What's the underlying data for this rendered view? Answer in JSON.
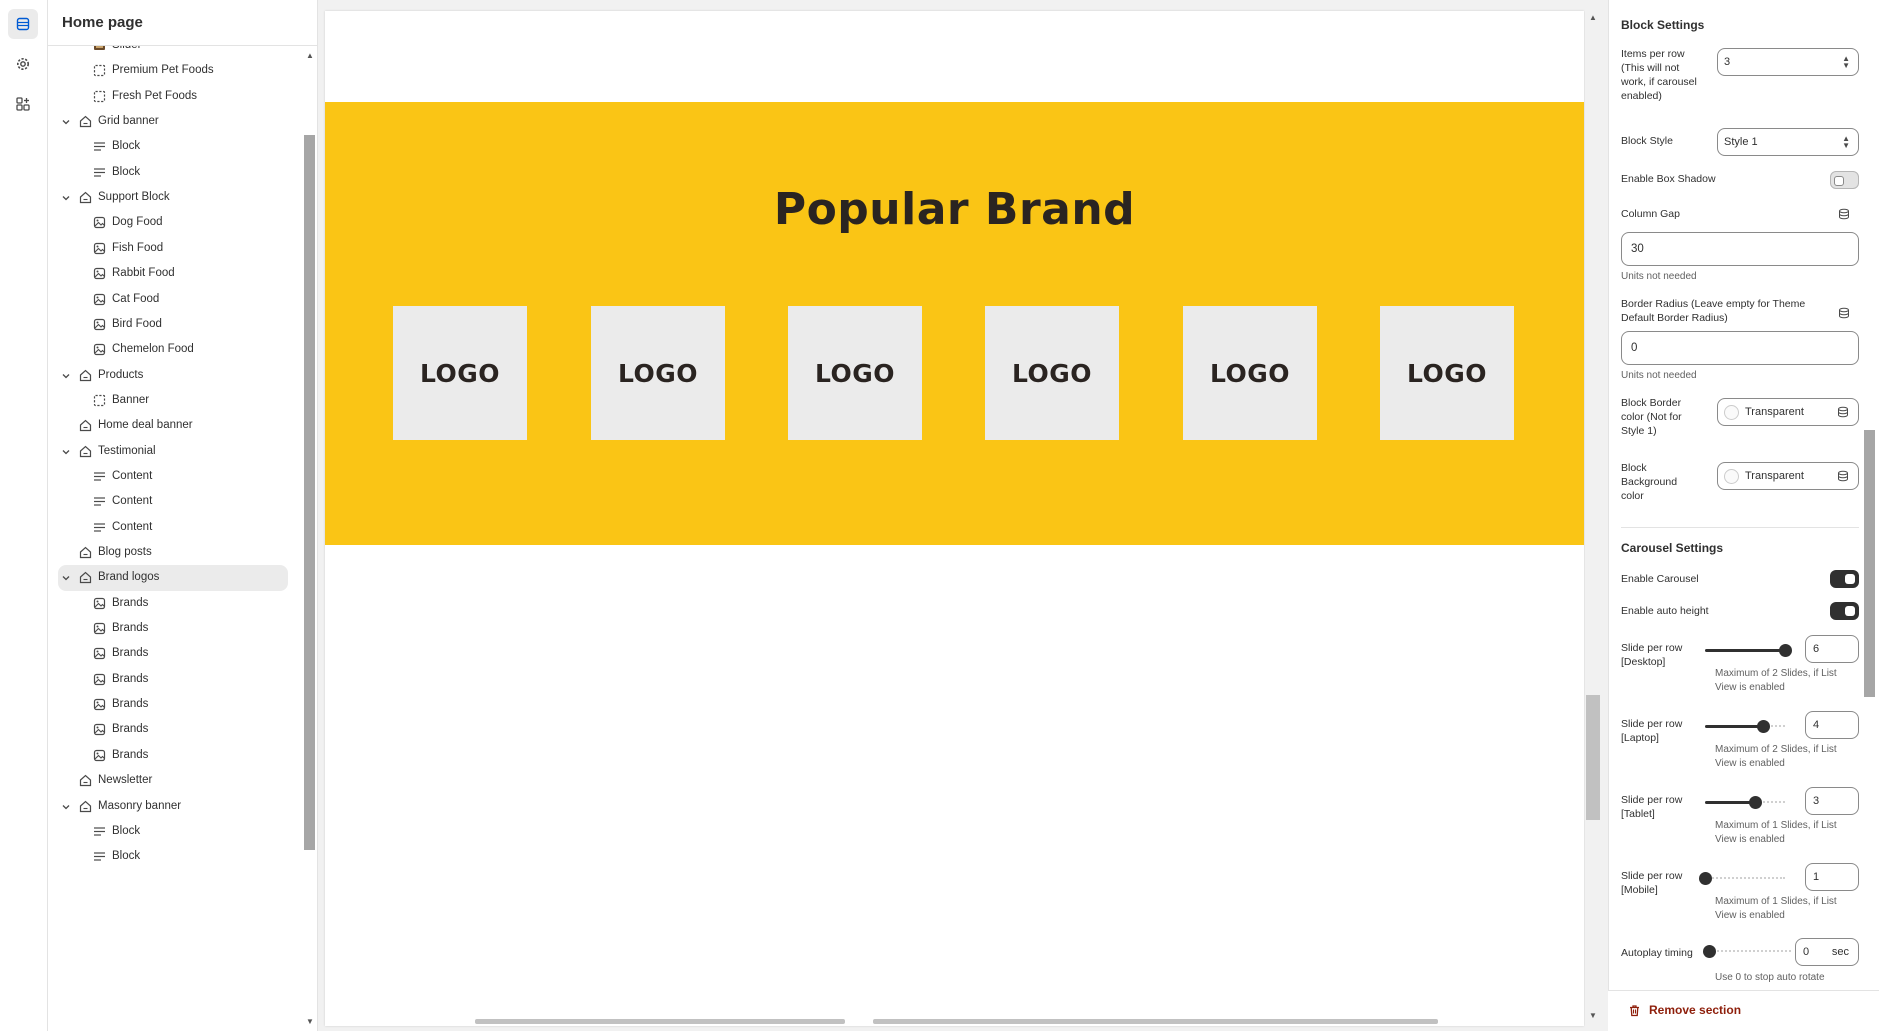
{
  "rail": {
    "items": [
      "sections-icon",
      "settings-gear-icon",
      "apps-icon"
    ]
  },
  "sidebar": {
    "title": "Home page",
    "items": [
      {
        "label": "Slider",
        "level": 1,
        "icon": "image-slider-icon"
      },
      {
        "label": "Premium Pet Foods",
        "level": 1,
        "icon": "dashed-square-icon"
      },
      {
        "label": "Fresh Pet Foods",
        "level": 1,
        "icon": "dashed-square-icon"
      },
      {
        "label": "Grid banner",
        "level": 0,
        "icon": "section-icon",
        "expanded": true
      },
      {
        "label": "Block",
        "level": 1,
        "icon": "text-lines-icon"
      },
      {
        "label": "Block",
        "level": 1,
        "icon": "text-lines-icon"
      },
      {
        "label": "Support Block",
        "level": 0,
        "icon": "section-icon",
        "expanded": true
      },
      {
        "label": "Dog Food",
        "level": 1,
        "icon": "image-icon"
      },
      {
        "label": "Fish Food",
        "level": 1,
        "icon": "image-icon"
      },
      {
        "label": "Rabbit Food",
        "level": 1,
        "icon": "image-icon"
      },
      {
        "label": "Cat Food",
        "level": 1,
        "icon": "image-icon"
      },
      {
        "label": "Bird Food",
        "level": 1,
        "icon": "image-icon"
      },
      {
        "label": "Chemelon Food",
        "level": 1,
        "icon": "image-icon"
      },
      {
        "label": "Products",
        "level": 0,
        "icon": "section-icon",
        "expanded": true
      },
      {
        "label": "Banner",
        "level": 1,
        "icon": "dashed-square-icon"
      },
      {
        "label": "Home deal banner",
        "level": 0,
        "icon": "section-icon"
      },
      {
        "label": "Testimonial",
        "level": 0,
        "icon": "section-icon",
        "expanded": true
      },
      {
        "label": "Content",
        "level": 1,
        "icon": "text-lines-icon"
      },
      {
        "label": "Content",
        "level": 1,
        "icon": "text-lines-icon"
      },
      {
        "label": "Content",
        "level": 1,
        "icon": "text-lines-icon"
      },
      {
        "label": "Blog posts",
        "level": 0,
        "icon": "section-icon"
      },
      {
        "label": "Brand logos",
        "level": 0,
        "icon": "section-icon",
        "expanded": true,
        "selected": true
      },
      {
        "label": "Brands",
        "level": 1,
        "icon": "image-icon"
      },
      {
        "label": "Brands",
        "level": 1,
        "icon": "image-icon"
      },
      {
        "label": "Brands",
        "level": 1,
        "icon": "image-icon"
      },
      {
        "label": "Brands",
        "level": 1,
        "icon": "image-icon"
      },
      {
        "label": "Brands",
        "level": 1,
        "icon": "image-icon"
      },
      {
        "label": "Brands",
        "level": 1,
        "icon": "image-icon"
      },
      {
        "label": "Brands",
        "level": 1,
        "icon": "image-icon"
      },
      {
        "label": "Newsletter",
        "level": 0,
        "icon": "section-icon"
      },
      {
        "label": "Masonry banner",
        "level": 0,
        "icon": "section-icon",
        "expanded": true
      },
      {
        "label": "Block",
        "level": 1,
        "icon": "text-lines-icon"
      },
      {
        "label": "Block",
        "level": 1,
        "icon": "text-lines-icon"
      }
    ]
  },
  "preview": {
    "section_title": "Popular Brand",
    "band_color": "#fac515",
    "logos": [
      "LOGO",
      "LOGO",
      "LOGO",
      "LOGO",
      "LOGO",
      "LOGO"
    ]
  },
  "settings": {
    "block_settings_title": "Block Settings",
    "items_per_row": {
      "label": "Items per row (This will not work, if carousel enabled)",
      "value": "3"
    },
    "block_style": {
      "label": "Block Style",
      "value": "Style 1"
    },
    "box_shadow": {
      "label": "Enable Box Shadow",
      "on": false
    },
    "column_gap": {
      "label": "Column Gap",
      "value": "30",
      "hint": "Units not needed"
    },
    "border_radius": {
      "label": "Border Radius (Leave empty for Theme Default Border Radius)",
      "value": "0",
      "hint": "Units not needed"
    },
    "border_color": {
      "label": "Block Border color (Not for Style 1)",
      "value": "Transparent"
    },
    "bg_color": {
      "label": "Block Background color",
      "value": "Transparent"
    },
    "carousel_settings_title": "Carousel Settings",
    "enable_carousel": {
      "label": "Enable Carousel",
      "on": true
    },
    "auto_height": {
      "label": "Enable auto height",
      "on": true
    },
    "slides": [
      {
        "label": "Slide per row [Desktop]",
        "value": "6",
        "level": 1.0,
        "hint": "Maximum of 2 Slides, if List View is enabled"
      },
      {
        "label": "Slide per row [Laptop]",
        "value": "4",
        "level": 0.72,
        "hint": "Maximum of 2 Slides, if List View is enabled"
      },
      {
        "label": "Slide per row [Tablet]",
        "value": "3",
        "level": 0.62,
        "hint": "Maximum of 1 Slides, if List View is enabled"
      },
      {
        "label": "Slide per row [Mobile]",
        "value": "1",
        "level": 0.0,
        "hint": "Maximum of 1 Slides, if List View is enabled"
      }
    ],
    "autoplay": {
      "label": "Autoplay timing",
      "value": "0",
      "unit": "sec",
      "level": 0.0,
      "hint": "Use 0 to stop auto rotate"
    },
    "remove_label": "Remove section"
  }
}
